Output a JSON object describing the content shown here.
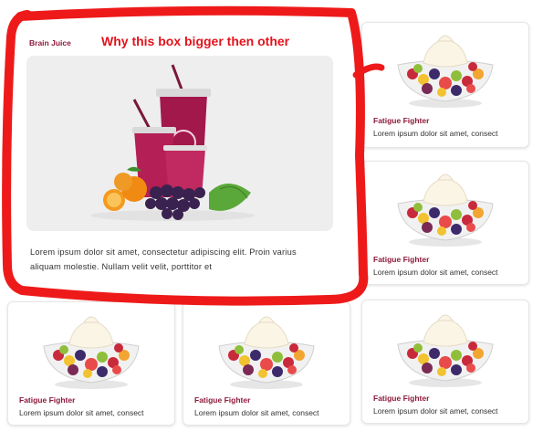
{
  "featured": {
    "title": "Brain Juice",
    "description": "Lorem ipsum dolor sit amet, consectetur adipiscing elit. Proin varius aliquam molestie. Nullam velit velit, porttitor et"
  },
  "annotation": {
    "text": "Why this box bigger then other"
  },
  "products": [
    {
      "title": "Fatigue Fighter",
      "description": "Lorem ipsum dolor sit amet, consect"
    },
    {
      "title": "Fatigue Fighter",
      "description": "Lorem ipsum dolor sit amet, consect"
    },
    {
      "title": "Fatigue Fighter",
      "description": "Lorem ipsum dolor sit amet, consect"
    },
    {
      "title": "Fatigue Fighter",
      "description": "Lorem ipsum dolor sit amet, consect"
    },
    {
      "title": "Fatigue Fighter",
      "description": "Lorem ipsum dolor sit amet, consect"
    }
  ],
  "colors": {
    "accent": "#8e1a3c",
    "annotation": "#e3121b",
    "card_border": "#e6e6e6"
  }
}
